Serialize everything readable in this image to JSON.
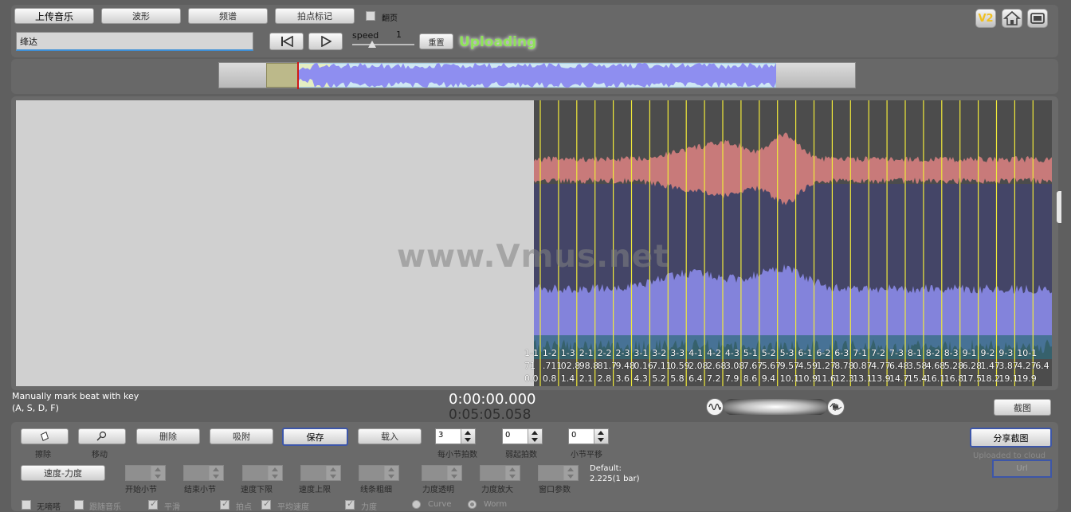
{
  "toolbar": {
    "upload_music": "上传音乐",
    "waveform": "波形",
    "spectrum": "频谱",
    "beat_mark": "拍点标记",
    "flip_page": "翻页",
    "reset": "重置",
    "speed_label": "speed",
    "speed_value": "1",
    "status": "Uploading",
    "title_value": "绛达"
  },
  "corner_icons": {
    "v2": "V2",
    "home": "home-icon",
    "window": "window-icon"
  },
  "main": {
    "watermark": "www.Vmus.net",
    "beat_labels": [
      {
        "id": "1-1",
        "v1": "71",
        "v2": "0.0"
      },
      {
        "id": "1-2",
        "v1": ".711",
        "v2": "0.8"
      },
      {
        "id": "1-3",
        "v1": "02.8",
        "v2": "1.4"
      },
      {
        "id": "2-1",
        "v1": "98.8",
        "v2": "2.1"
      },
      {
        "id": "2-2",
        "v1": "81.7",
        "v2": "2.8"
      },
      {
        "id": "2-3",
        "v1": "9.48",
        "v2": "3.6"
      },
      {
        "id": "3-1",
        "v1": "0.16",
        "v2": "4.3"
      },
      {
        "id": "3-2",
        "v1": "7.11",
        "v2": "5.2"
      },
      {
        "id": "3-3",
        "v1": "0.59",
        "v2": "5.8"
      },
      {
        "id": "4-1",
        "v1": "2.08",
        "v2": "6.4"
      },
      {
        "id": "4-2",
        "v1": "2.68",
        "v2": "7.2"
      },
      {
        "id": "4-3",
        "v1": "3.08",
        "v2": "7.9"
      },
      {
        "id": "5-1",
        "v1": "7.67",
        "v2": "8.6"
      },
      {
        "id": "5-2",
        "v1": "5.67",
        "v2": "9.4"
      },
      {
        "id": "5-3",
        "v1": "9.57",
        "v2": "10.1"
      },
      {
        "id": "6-1",
        "v1": "4.59",
        "v2": "10.9"
      },
      {
        "id": "6-2",
        "v1": "1.27",
        "v2": "11.6"
      },
      {
        "id": "6-3",
        "v1": "8.78",
        "v2": "12.3"
      },
      {
        "id": "7-1",
        "v1": "0.87",
        "v2": "13.1"
      },
      {
        "id": "7-2",
        "v1": "4.77",
        "v2": "13.9"
      },
      {
        "id": "7-3",
        "v1": "6.48",
        "v2": "14.7"
      },
      {
        "id": "8-1",
        "v1": "3.58",
        "v2": "15.4"
      },
      {
        "id": "8-2",
        "v1": "4.68",
        "v2": "16.1"
      },
      {
        "id": "8-3",
        "v1": "5.28",
        "v2": "16.8"
      },
      {
        "id": "9-1",
        "v1": "6.28",
        "v2": "17.5"
      },
      {
        "id": "9-2",
        "v1": "1.47",
        "v2": "18.2"
      },
      {
        "id": "9-3",
        "v1": "3.87",
        "v2": "19.1"
      },
      {
        "id": "10-1",
        "v1": "4.27",
        "v2": "19.9"
      },
      {
        "id": "",
        "v1": "6.4",
        "v2": ""
      }
    ]
  },
  "info": {
    "hint_line1": "Manually mark beat with key",
    "hint_line2": "(A, S, D, F)",
    "time_current": "0:00:00.000",
    "time_total": "0:05:05.058",
    "screenshot": "截图"
  },
  "controls": {
    "eraser": "擦除",
    "move": "移动",
    "delete": "删除",
    "snap": "吸附",
    "save": "保存",
    "load": "载入",
    "beats_per_bar_value": "3",
    "beats_per_bar_label": "每小节拍数",
    "pickup_value": "0",
    "pickup_label": "弱起拍数",
    "bar_shift_value": "0",
    "bar_shift_label": "小节平移",
    "share_screenshot": "分享截图",
    "uploaded": "Uploaded to cloud",
    "url": "Url",
    "tempo_dynamics": "速度-力度",
    "start_bar": "开始小节",
    "end_bar": "结束小节",
    "tempo_min": "速度下限",
    "tempo_max": "速度上限",
    "line_width": "线条粗细",
    "dyn_transparency": "力度透明",
    "dyn_zoom": "力度放大",
    "window_param": "窗口参数",
    "default_line1": "Default:",
    "default_line2": "2.225(1 bar)",
    "no_metronome": "无嘀嗒",
    "follow_music": "跟随音乐",
    "smooth": "平滑",
    "beat_point": "拍点",
    "avg_tempo": "平均速度",
    "dynamics": "力度",
    "curve": "Curve",
    "worm": "Worm"
  },
  "colors": {
    "status_green": "#8fe35a",
    "beat_line": "#f1ea3a",
    "wave_blue": "#8e8ef0",
    "wave_red": "#c87a7a"
  }
}
